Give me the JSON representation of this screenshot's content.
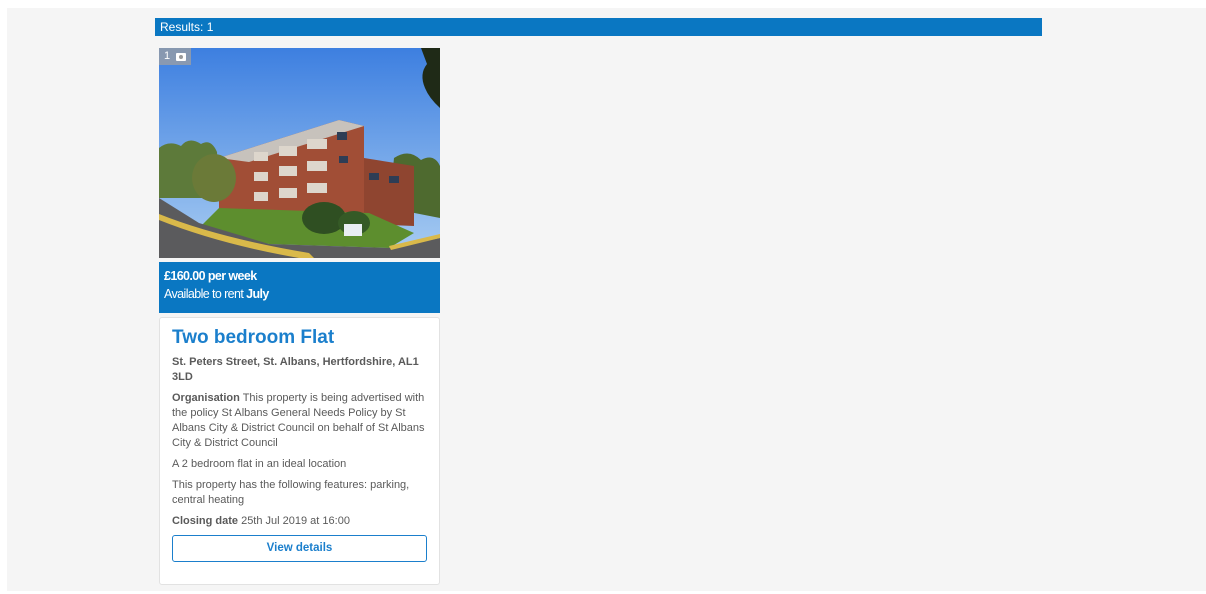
{
  "results": {
    "label": "Results:",
    "count": "1"
  },
  "listing": {
    "photo_count": "1",
    "photo_icon": "camera-icon",
    "price": "£160.00 per week",
    "availability_prefix": "Available to rent ",
    "availability_month": "July",
    "title": "Two bedroom Flat",
    "address": "St. Peters Street, St. Albans, Hertfordshire, AL1 3LD",
    "organisation_label": "Organisation",
    "organisation_text": " This property is being advertised with the policy St Albans General Needs Policy by St Albans City & District Council on behalf of St Albans City & District Council",
    "description": "A 2 bedroom flat in an ideal location",
    "features": "This property has the following features: parking, central heating",
    "closing_label": "Closing date",
    "closing_value": " 25th Jul 2019 at 16:00",
    "button_label": "View details"
  },
  "colors": {
    "accent": "#0a77c2",
    "title": "#1b7fcc",
    "page_background": "#f5f5f5"
  }
}
